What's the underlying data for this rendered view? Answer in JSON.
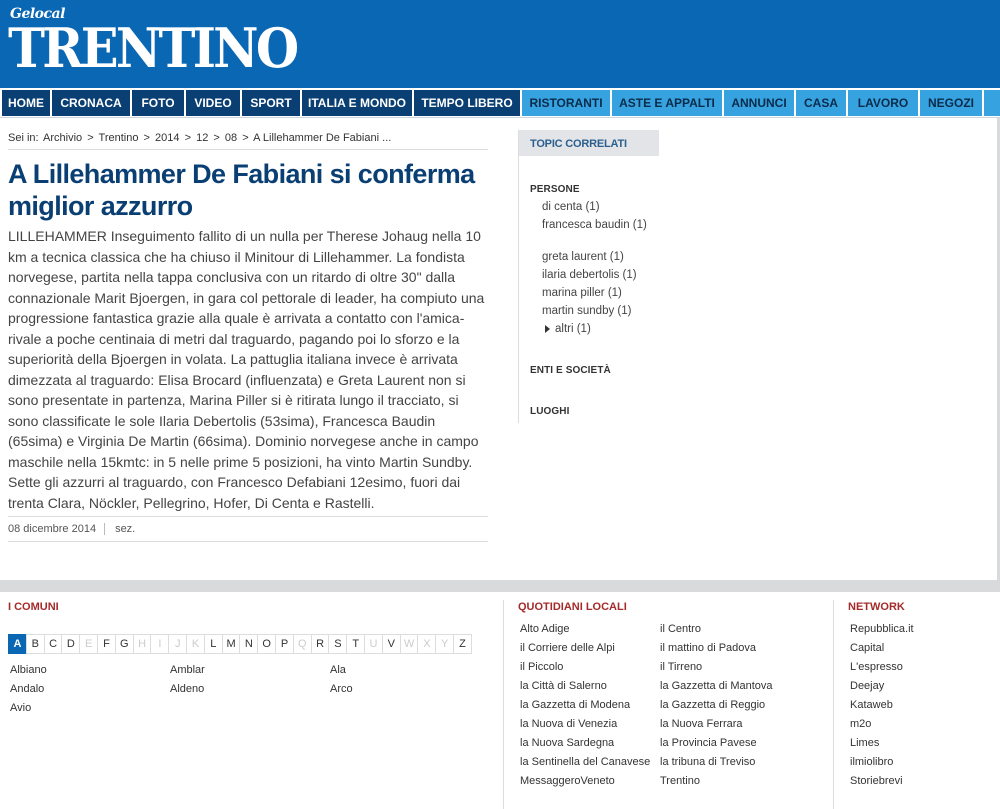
{
  "header": {
    "logo_top": "Gelocal",
    "logo_main": "TRENTINO"
  },
  "nav": {
    "items": [
      {
        "label": "HOME",
        "style": "main"
      },
      {
        "label": "CRONACA",
        "style": "main"
      },
      {
        "label": "FOTO",
        "style": "main"
      },
      {
        "label": "VIDEO",
        "style": "main"
      },
      {
        "label": "SPORT",
        "style": "main"
      },
      {
        "label": "ITALIA E MONDO",
        "style": "main"
      },
      {
        "label": "TEMPO LIBERO",
        "style": "main"
      },
      {
        "label": "RISTORANTI",
        "style": "alt"
      },
      {
        "label": "ASTE E APPALTI",
        "style": "alt"
      },
      {
        "label": "ANNUNCI",
        "style": "alt"
      },
      {
        "label": "CASA",
        "style": "alt"
      },
      {
        "label": "LAVORO",
        "style": "alt"
      },
      {
        "label": "NEGOZI",
        "style": "alt"
      }
    ]
  },
  "breadcrumb": {
    "prefix": "Sei in:",
    "items": [
      "Archivio",
      "Trentino",
      "2014",
      "12",
      "08",
      "A Lillehammer De Fabiani ..."
    ],
    "separator": ">"
  },
  "article": {
    "title": "A Lillehammer De Fabiani si conferma miglior azzurro",
    "body": "LILLEHAMMER Inseguimento fallito di un nulla per Therese Johaug nella 10 km a tecnica classica che ha chiuso il Minitour di Lillehammer. La fondista norvegese, partita nella tappa conclusiva con un ritardo di oltre 30\" dalla connazionale Marit Bjoergen, in gara col pettorale di leader, ha compiuto una progressione fantastica grazie alla quale è arrivata a contatto con l'amica-rivale a poche centinaia di metri dal traguardo, pagando poi lo sforzo e la superiorità della Bjoergen in volata. La pattuglia italiana invece è arrivata dimezzata al traguardo: Elisa Brocard (influenzata) e Greta Laurent non si sono presentate in partenza, Marina Piller si è ritirata lungo il tracciato, si sono classificate le sole Ilaria Debertolis (53sima), Francesca Baudin (65sima) e Virginia De Martin (66sima). Dominio norvegese anche in campo maschile nella 15kmtc: in 5 nelle prime 5 posizioni, ha vinto Martin Sundby. Sette gli azzurri al traguardo, con Francesco Defabiani 12esimo, fuori dai trenta Clara, Nöckler, Pellegrino, Hofer, Di Centa e Rastelli.",
    "date": "08 dicembre 2014",
    "section": "sez."
  },
  "sidebar": {
    "header": "TOPIC CORRELATI",
    "persone_label": "PERSONE",
    "persone": [
      {
        "text": "di centa (1)"
      },
      {
        "text": "francesca baudin (1)"
      },
      {
        "text": "greta laurent (1)"
      },
      {
        "text": "ilaria debertolis (1)"
      },
      {
        "text": "marina piller (1)"
      },
      {
        "text": "martin sundby (1)"
      }
    ],
    "altri": "altri (1)",
    "enti_label": "ENTI E SOCIETÀ",
    "luoghi_label": "LUOGHI"
  },
  "footer": {
    "comuni_title": "I COMUNI",
    "letters": [
      "A",
      "B",
      "C",
      "D",
      "E",
      "F",
      "G",
      "H",
      "I",
      "J",
      "K",
      "L",
      "M",
      "N",
      "O",
      "P",
      "Q",
      "R",
      "S",
      "T",
      "U",
      "V",
      "W",
      "X",
      "Y",
      "Z"
    ],
    "disabled_letters": [
      "E",
      "H",
      "I",
      "J",
      "K",
      "Q",
      "U",
      "W",
      "X",
      "Y"
    ],
    "active_letter": "A",
    "comuni": [
      "Albiano",
      "Amblar",
      "Ala",
      "Andalo",
      "Aldeno",
      "Arco",
      "Avio"
    ],
    "quotidiani_title": "QUOTIDIANI LOCALI",
    "quotidiani_col1": [
      "Alto Adige",
      "il Corriere delle Alpi",
      "il Piccolo",
      "la Città di Salerno",
      "la Gazzetta di Modena",
      "la Nuova di Venezia",
      "la Nuova Sardegna",
      "la Sentinella del Canavese",
      "MessaggeroVeneto"
    ],
    "quotidiani_col2": [
      "il Centro",
      "il mattino di Padova",
      "il Tirreno",
      "la Gazzetta di Mantova",
      "la Gazzetta di Reggio",
      "la Nuova Ferrara",
      "la Provincia Pavese",
      "la tribuna di Treviso",
      "Trentino"
    ],
    "network_title": "NETWORK",
    "network": [
      "Repubblica.it",
      "Capital",
      "L'espresso",
      "Deejay",
      "Kataweb",
      "m2o",
      "Limes",
      "ilmiolibro",
      "Storiebrevi"
    ]
  }
}
